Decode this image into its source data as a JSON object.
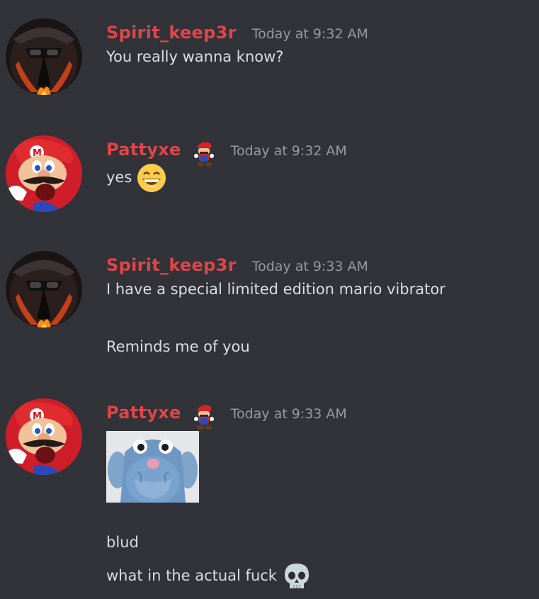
{
  "colors": {
    "background": "#313338",
    "username": "#e0454a",
    "timestamp": "#949ba4",
    "text": "#dbdee1"
  },
  "messages": [
    {
      "username": "Spirit_keep3r",
      "timestamp": "Today at 9:32 AM",
      "avatar_icon": "dark-masked-figure-avatar",
      "lines": [
        "You really wanna know?"
      ]
    },
    {
      "username": "Pattyxe",
      "timestamp": "Today at 9:32 AM",
      "avatar_icon": "mario-avatar",
      "badge_icon": "mario-badge-icon",
      "lines": [
        "yes"
      ],
      "emoji": "grinning-face-emoji"
    },
    {
      "username": "Spirit_keep3r",
      "timestamp": "Today at 9:33 AM",
      "avatar_icon": "dark-masked-figure-avatar",
      "lines": [
        "I have a special limited edition mario vibrator",
        "Reminds me of you"
      ]
    },
    {
      "username": "Pattyxe",
      "timestamp": "Today at 9:33 AM",
      "avatar_icon": "mario-avatar",
      "badge_icon": "mario-badge-icon",
      "attachment_icon": "blue-rat-image",
      "lines": [
        "blud",
        "what in the actual fuck"
      ],
      "emoji": "skull-emoji"
    }
  ]
}
